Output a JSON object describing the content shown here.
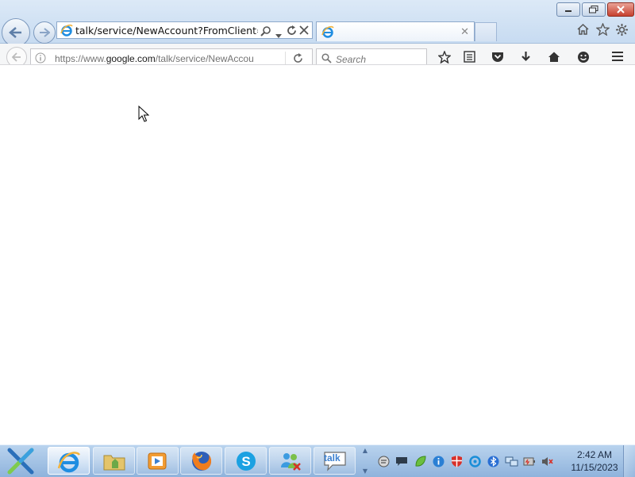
{
  "ie": {
    "address_url": "talk/service/NewAccount?FromClient=Talk",
    "tab_title": ""
  },
  "firefox": {
    "url_prefix": "https://www.",
    "url_host": "google.com",
    "url_path": "/talk/service/NewAccou",
    "search_placeholder": "Search"
  },
  "taskbar": {
    "pinned": [
      {
        "name": "internet-explorer",
        "icon": "ie-icon",
        "active": true
      },
      {
        "name": "file-explorer",
        "icon": "folder-icon",
        "active": false
      },
      {
        "name": "media-player",
        "icon": "media-player-icon",
        "active": false
      },
      {
        "name": "firefox",
        "icon": "firefox-icon",
        "active": false
      },
      {
        "name": "skype",
        "icon": "skype-icon",
        "active": false
      },
      {
        "name": "messenger",
        "icon": "messenger-icon",
        "active": false
      },
      {
        "name": "google-talk",
        "icon": "google-talk-icon",
        "active": false
      }
    ],
    "google_talk_label": "talk"
  },
  "tray": {
    "icons": [
      "chat-icon",
      "speech-bubble-icon",
      "leaf-icon",
      "info-icon",
      "shield-icon",
      "sync-icon",
      "bluetooth-icon",
      "network-icon",
      "power-icon",
      "volume-muted-icon"
    ]
  },
  "clock": {
    "time": "2:42 AM",
    "date": "11/15/2023"
  },
  "colors": {
    "ie_frame": "#c7dbf1",
    "taskbar": "#8fb3dc",
    "close_button": "#c7412f"
  }
}
